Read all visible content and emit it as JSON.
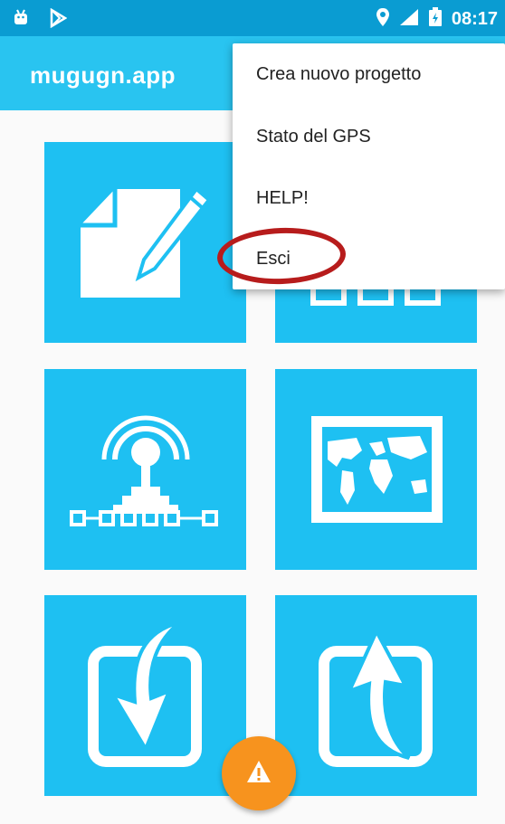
{
  "status_bar": {
    "time": "08:17",
    "icons": [
      "android-icon",
      "play-store-icon",
      "location-icon",
      "signal-icon",
      "battery-icon"
    ]
  },
  "app_bar": {
    "title": "mugugn.app"
  },
  "overflow_menu": {
    "items": [
      {
        "label": "Crea nuovo progetto"
      },
      {
        "label": "Stato del GPS"
      },
      {
        "label": "HELP!"
      },
      {
        "label": "Esci"
      }
    ],
    "highlighted_item": "Esci"
  },
  "tiles": [
    {
      "icon": "edit-document-icon"
    },
    {
      "icon": "grid-list-icon"
    },
    {
      "icon": "gps-antenna-icon"
    },
    {
      "icon": "world-map-icon"
    },
    {
      "icon": "download-arrow-icon"
    },
    {
      "icon": "upload-arrow-icon"
    }
  ],
  "fab": {
    "icon": "warning-icon"
  },
  "colors": {
    "status_bar": "#0a9cd2",
    "app_bar": "#29c4f0",
    "tile": "#1ec0f2",
    "fab": "#f7931e",
    "highlight": "#b71c1c"
  }
}
